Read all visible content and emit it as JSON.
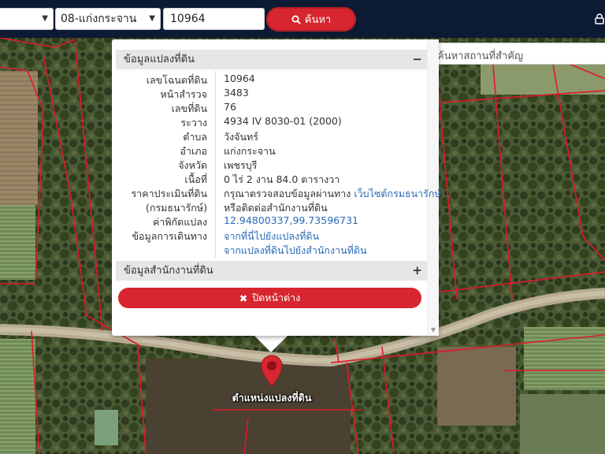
{
  "topbar": {
    "province_value": "",
    "district_value": "08-แก่งกระจาน",
    "parcel_number_value": "10964",
    "search_button_label": "ค้นหา"
  },
  "place_search": {
    "placeholder": "ค้นหาสถานที่สำคัญ"
  },
  "popup": {
    "section1_title": "ข้อมูลแปลงที่ดิน",
    "section1_toggle": "−",
    "rows": [
      {
        "label": "เลขโฉนดที่ดิน",
        "value": "10964"
      },
      {
        "label": "หน้าสำรวจ",
        "value": "3483"
      },
      {
        "label": "เลขที่ดิน",
        "value": "76"
      },
      {
        "label": "ระวาง",
        "value": "4934 IV 8030-01 (2000)"
      },
      {
        "label": "ตำบล",
        "value": "วังจันทร์"
      },
      {
        "label": "อำเภอ",
        "value": "แก่งกระจาน"
      },
      {
        "label": "จังหวัด",
        "value": "เพชรบุรี"
      },
      {
        "label": "เนื้อที่",
        "value": "0 ไร่ 2 งาน 84.0 ตารางวา"
      },
      {
        "label": "ราคาประเมินที่ดิน",
        "value": "กรุณาตรวจสอบข้อมูลผ่านทาง",
        "link": "เว็บไซต์กรมธนารักษ์"
      },
      {
        "label": "(กรมธนารักษ์)",
        "value": "หรือติดต่อสำนักงานที่ดิน"
      },
      {
        "label": "ค่าพิกัดแปลง",
        "link": "12.94800337,99.73596731"
      },
      {
        "label": "ข้อมูลการเดินทาง",
        "link": "จากที่นี่ไปยังแปลงที่ดิน"
      },
      {
        "label": "",
        "link": "จากแปลงที่ดินไปยังสำนักงานที่ดิน"
      }
    ],
    "section2_title": "ข้อมูลสำนักงานที่ดิน",
    "section2_toggle": "+",
    "close_button_label": "ปิดหน้าต่าง"
  },
  "marker": {
    "label": "ตำแหน่งแปลงที่ดิน"
  },
  "colors": {
    "topbar_bg": "#0c1a33",
    "accent_red": "#d7262f",
    "link_blue": "#2a6ab8"
  }
}
